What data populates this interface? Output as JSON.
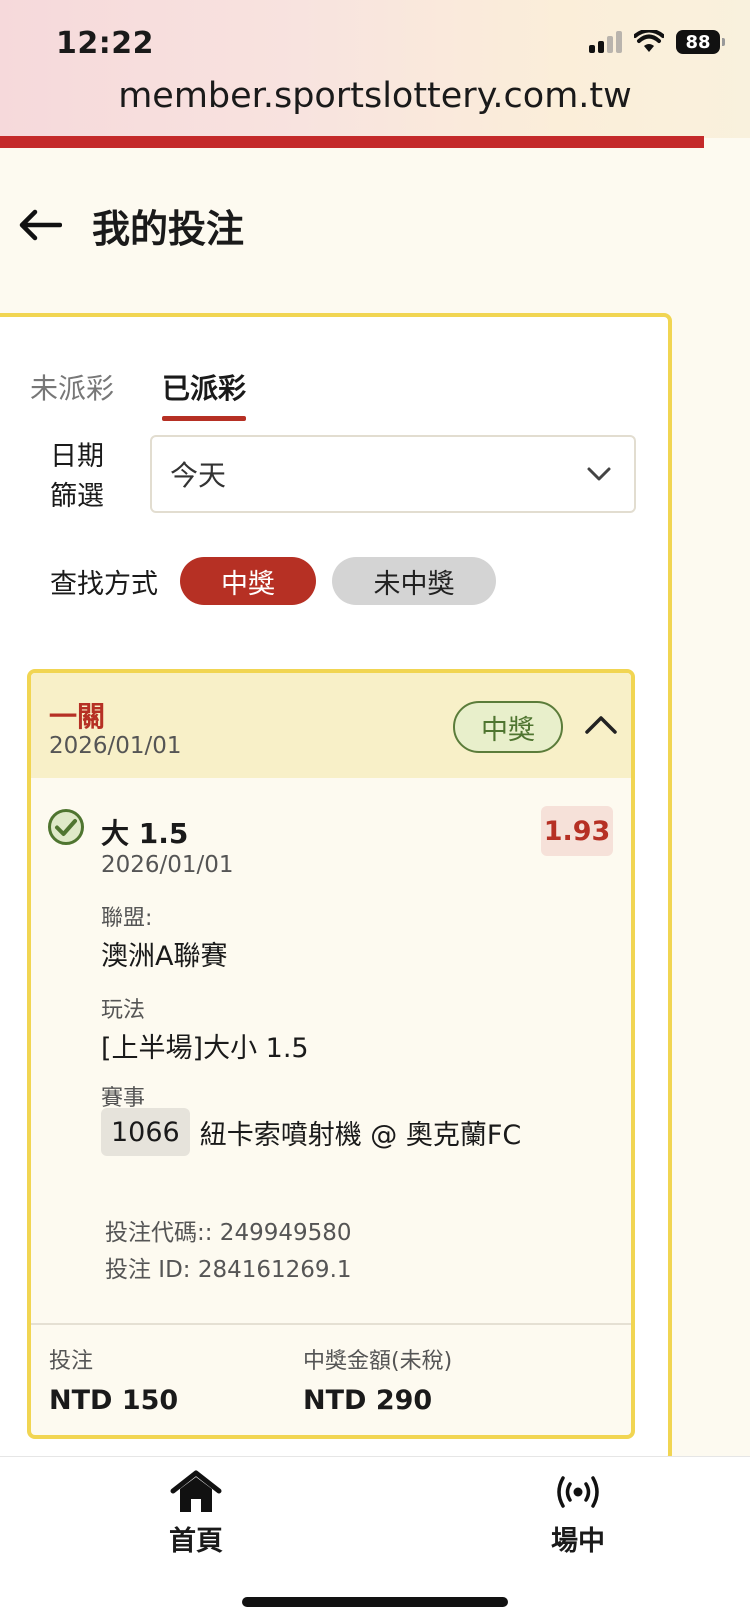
{
  "status_bar": {
    "time": "12:22",
    "battery": "88"
  },
  "browser": {
    "url": "member.sportslottery.com.tw"
  },
  "header": {
    "title": "我的投注"
  },
  "tabs": [
    {
      "label": "未派彩",
      "active": false
    },
    {
      "label": "已派彩",
      "active": true
    }
  ],
  "filter": {
    "label_line1": "日期",
    "label_line2": "篩選",
    "selected": "今天"
  },
  "search": {
    "label": "查找方式",
    "options": [
      "中獎",
      "未中獎"
    ],
    "selected": "中獎"
  },
  "bet_card": {
    "type": "一關",
    "date": "2026/01/01",
    "status": "中獎",
    "selection": {
      "name": "大 1.5",
      "date": "2026/01/01",
      "odds": "1.93",
      "league_label": "聯盟:",
      "league": "澳洲A聯賽",
      "market_label": "玩法",
      "market": "[上半場]大小 1.5",
      "event_label": "賽事",
      "event_code": "1066",
      "event_name": "紐卡索噴射機 @ 奧克蘭FC"
    },
    "bet_code": "投注代碼:: 249949580",
    "bet_id": "投注 ID: 284161269.1",
    "stake_label": "投注",
    "stake": "NTD 150",
    "payout_label": "中獎金額(未稅)",
    "payout": "NTD 290"
  },
  "bottom_nav": {
    "home": "首頁",
    "live": "場中"
  },
  "colors": {
    "accent_red": "#b63024",
    "panel_border": "#f1d552",
    "win_green": "#4f7530"
  }
}
